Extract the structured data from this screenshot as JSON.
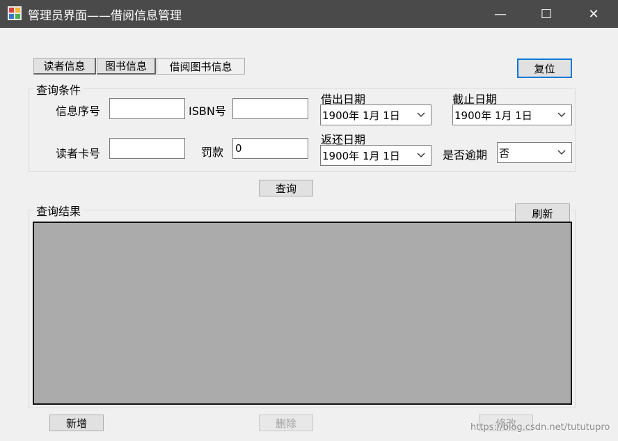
{
  "window": {
    "title": "管理员界面——借阅信息管理",
    "app_icon": "app-grid-icon",
    "controls": {
      "minimize": "—",
      "maximize": "☐",
      "close": "✕"
    }
  },
  "tabs": [
    {
      "label": "读者信息",
      "active": false
    },
    {
      "label": "图书信息",
      "active": false
    },
    {
      "label": "借阅图书信息",
      "active": true
    }
  ],
  "reset_button": "复位",
  "query_group": {
    "legend": "查询条件",
    "info_id_label": "信息序号",
    "info_id_value": "",
    "isbn_label": "ISBN号",
    "isbn_value": "",
    "reader_card_label": "读者卡号",
    "reader_card_value": "",
    "fine_label": "罚款",
    "fine_value": "0",
    "borrow_date_label": "借出日期",
    "borrow_date_value": "1900年 1月 1日",
    "due_date_label": "截止日期",
    "due_date_value": "1900年 1月 1日",
    "return_date_label": "返还日期",
    "return_date_value": "1900年 1月 1日",
    "overdue_label": "是否逾期",
    "overdue_value": "否"
  },
  "query_button": "查询",
  "results_group": {
    "legend": "查询结果",
    "refresh_button": "刷新"
  },
  "bottom_buttons": {
    "add": "新增",
    "delete": "删除",
    "edit": "修改"
  },
  "watermark": "https://blog.csdn.net/tututupro"
}
